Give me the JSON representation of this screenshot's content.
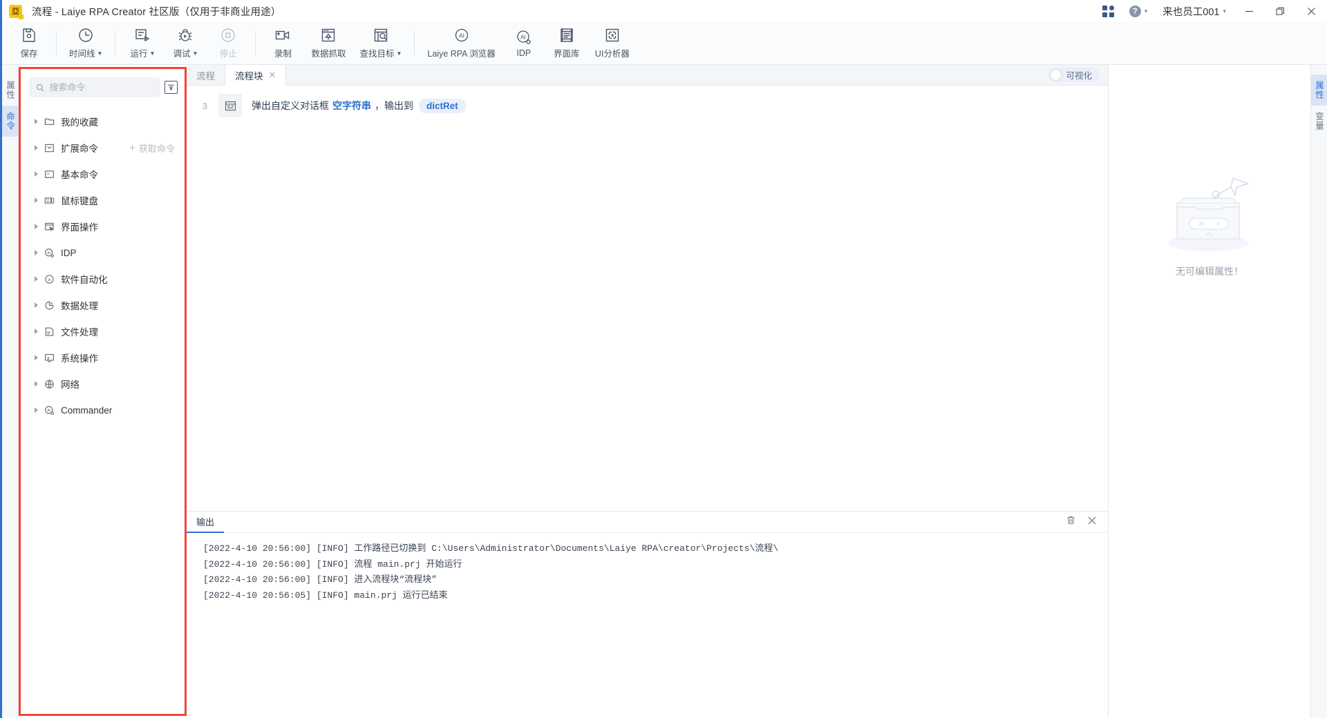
{
  "titlebar": {
    "app_icon": "laiye-logo-icon",
    "title": "流程 - Laiye RPA Creator 社区版（仅用于非商业用途）",
    "apps_icon": "apps-grid-icon",
    "help_icon": "help-question-icon",
    "user_name": "来也员工001",
    "minimize": "−",
    "maximize": "▢",
    "close": "✕"
  },
  "toolbar": {
    "groups": [
      {
        "items": [
          {
            "label": "保存",
            "icon": "save-icon",
            "caret": false,
            "disabled": false
          }
        ]
      },
      {
        "items": [
          {
            "label": "时间线",
            "icon": "timeline-clock-icon",
            "caret": true,
            "disabled": false
          }
        ]
      },
      {
        "items": [
          {
            "label": "运行",
            "icon": "run-icon",
            "caret": true,
            "disabled": false
          },
          {
            "label": "调试",
            "icon": "debug-bug-icon",
            "caret": true,
            "disabled": false
          },
          {
            "label": "停止",
            "icon": "stop-icon",
            "caret": false,
            "disabled": true
          }
        ]
      },
      {
        "items": [
          {
            "label": "录制",
            "icon": "record-camera-icon",
            "caret": false,
            "disabled": false
          },
          {
            "label": "数据抓取",
            "icon": "data-capture-icon",
            "caret": false,
            "disabled": false
          },
          {
            "label": "查找目标",
            "icon": "find-target-icon",
            "caret": true,
            "disabled": false
          }
        ]
      },
      {
        "items": [
          {
            "label": "Laiye RPA 浏览器",
            "icon": "ai-browser-icon",
            "caret": false,
            "disabled": false
          },
          {
            "label": "IDP",
            "icon": "ai-idp-icon",
            "caret": false,
            "disabled": false
          },
          {
            "label": "界面库",
            "icon": "ui-library-icon",
            "caret": false,
            "disabled": false
          },
          {
            "label": "UI分析器",
            "icon": "ui-analyzer-icon",
            "caret": false,
            "disabled": false
          }
        ]
      }
    ]
  },
  "left_rail": {
    "tabs": [
      {
        "label": "属性",
        "active": false
      },
      {
        "label": "命令",
        "active": true
      }
    ]
  },
  "right_rail": {
    "tabs": [
      {
        "label": "属性",
        "active": true
      },
      {
        "label": "变量",
        "active": false
      }
    ]
  },
  "command_panel": {
    "highlight_color": "#f44336",
    "search": {
      "placeholder": "搜索命令",
      "value": "",
      "icon": "search-icon"
    },
    "filter_button_icon": "filter-icon",
    "tree": [
      {
        "label": "我的收藏",
        "icon": "folder-icon",
        "action": null
      },
      {
        "label": "扩展命令",
        "icon": "extension-icon",
        "action": "获取命令"
      },
      {
        "label": "基本命令",
        "icon": "basic-command-icon",
        "action": null
      },
      {
        "label": "鼠标键盘",
        "icon": "mouse-keyboard-icon",
        "action": null
      },
      {
        "label": "界面操作",
        "icon": "ui-operation-icon",
        "action": null
      },
      {
        "label": "IDP",
        "icon": "ai-idp-icon",
        "action": null
      },
      {
        "label": "软件自动化",
        "icon": "ai-automation-icon",
        "action": null
      },
      {
        "label": "数据处理",
        "icon": "data-process-icon",
        "action": null
      },
      {
        "label": "文件处理",
        "icon": "file-process-icon",
        "action": null
      },
      {
        "label": "系统操作",
        "icon": "system-operation-icon",
        "action": null
      },
      {
        "label": "网络",
        "icon": "network-globe-icon",
        "action": null
      },
      {
        "label": "Commander",
        "icon": "ai-commander-icon",
        "action": null
      }
    ]
  },
  "editor": {
    "tabs": [
      {
        "label": "流程",
        "active": false,
        "closable": false
      },
      {
        "label": "流程块",
        "active": true,
        "closable": true,
        "close_icon": "close-icon"
      }
    ],
    "visualize_toggle": {
      "label": "可视化",
      "on": false
    },
    "nodes": [
      {
        "line_number": "3",
        "icon": "dialog-icon",
        "text_prefix": "弹出自定义对话框",
        "token": "空字符串",
        "text_middle": "，输出到",
        "variable": "dictRet"
      }
    ]
  },
  "output": {
    "tab_label": "输出",
    "clear_icon": "trash-icon",
    "close_icon": "close-icon",
    "lines": [
      "[2022-4-10 20:56:00] [INFO] 工作路径已切换到 C:\\Users\\Administrator\\Documents\\Laiye RPA\\creator\\Projects\\流程\\",
      "[2022-4-10 20:56:00] [INFO] 流程 main.prj 开始运行",
      "[2022-4-10 20:56:00] [INFO] 进入流程块“流程块”",
      "[2022-4-10 20:56:05] [INFO] main.prj 运行已结束"
    ]
  },
  "property_panel": {
    "empty_illustration": "empty-box-paperplane-illustration",
    "empty_text": "无可编辑属性！"
  }
}
